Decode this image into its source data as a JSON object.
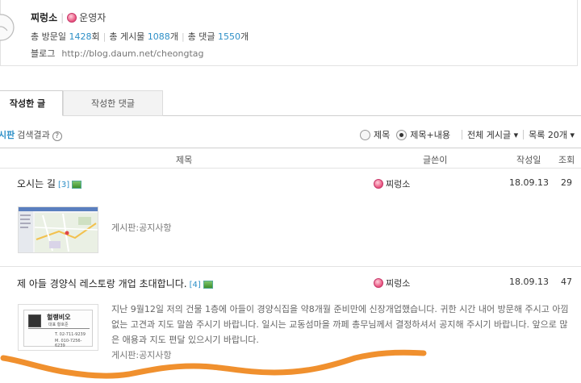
{
  "profile": {
    "name": "찌렁소",
    "role": "운영자",
    "visits_label": "총 방문일",
    "visits": "1428",
    "visits_unit": "회",
    "posts_label": "총 게시물",
    "posts": "1088",
    "posts_unit": "개",
    "comments_label": "총 댓글",
    "comments": "1550",
    "comments_unit": "개",
    "blog_label": "블로그",
    "blog_url": "http://blog.daum.net/cheongtag"
  },
  "tabs": [
    {
      "label": "작성한 글",
      "active": true
    },
    {
      "label": "작성한 댓글",
      "active": false
    }
  ],
  "filter": {
    "board": "시판",
    "result": "검색결과",
    "help": "?",
    "opt_title": "제목",
    "opt_title_content": "제목+내용",
    "selected": "제목+내용",
    "all_boards": "전체 게시글 ▾",
    "list_size": "목록 20개 ▾"
  },
  "columns": {
    "title": "제목",
    "author": "글쓴이",
    "date": "작성일",
    "views": "조회"
  },
  "posts": [
    {
      "title": "오시는 길",
      "count": "[3]",
      "author": "찌렁소",
      "date": "18.09.13",
      "views": "29",
      "board": "게시판:공지사항"
    },
    {
      "title": "제 아들 경양식 레스토랑 개업 초대합니다.",
      "count": "[4]",
      "author": "찌렁소",
      "date": "18.09.13",
      "views": "47",
      "excerpt": "지난 9월12일 저의 건물 1층에 아들이 경양식집을 약8개월 준비만에 신장개업했습니다. 귀한 시간 내어 방문해 주시고 아낌없는 고견과 지도 말씀 주시기 바랍니다. 일시는 교동섬마을 까페 총무님께서 결정하셔서 공지해 주시기 바랍니다. 앞으로 많은 애용과 지도 편달 있으시기 바랍니다.",
      "board": "게시판:공지사항",
      "card": {
        "name": "헐랭비오",
        "rep": "대표 황호준",
        "tel1": "T. 02-711-9239",
        "tel2": "M. 010-7256-6239"
      }
    }
  ],
  "colors": {
    "accent": "#2d8fc7",
    "annotation": "#f0902e"
  }
}
